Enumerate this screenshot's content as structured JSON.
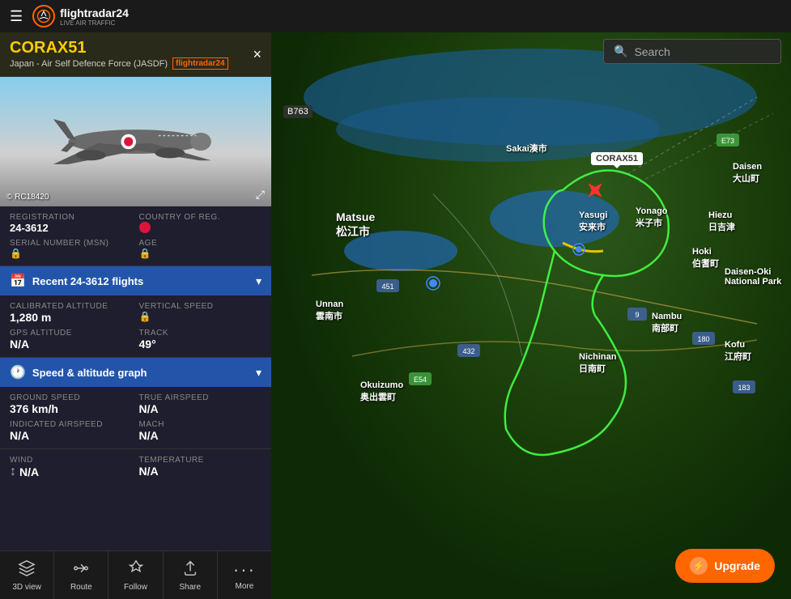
{
  "navbar": {
    "hamburger": "☰",
    "logo_text": "flightradar24",
    "logo_subtext": "LIVE AIR TRAFFIC"
  },
  "flight": {
    "callsign": "CORAX51",
    "airline": "Japan - Air Self Defence Force (JASDF)",
    "close_label": "×",
    "registration": "24-3612",
    "registration_label": "REGISTRATION",
    "country_label": "COUNTRY OF REG.",
    "serial_label": "SERIAL NUMBER (MSN)",
    "age_label": "AGE",
    "image_credit": "© RC18420",
    "recent_label": "Recent 24-3612 flights"
  },
  "flight_data": {
    "calibrated_altitude_label": "CALIBRATED ALTITUDE",
    "calibrated_altitude": "1,280 m",
    "vertical_speed_label": "VERTICAL SPEED",
    "gps_altitude_label": "GPS ALTITUDE",
    "gps_altitude": "N/A",
    "track_label": "TRACK",
    "track": "49°"
  },
  "speed_data": {
    "section_label": "Speed & altitude graph",
    "ground_speed_label": "GROUND SPEED",
    "ground_speed": "376 km/h",
    "true_airspeed_label": "TRUE AIRSPEED",
    "true_airspeed": "N/A",
    "indicated_airspeed_label": "INDICATED AIRSPEED",
    "indicated_airspeed": "N/A",
    "mach_label": "MACH",
    "mach": "N/A"
  },
  "wind_data": {
    "wind_label": "WIND",
    "wind": "N/A",
    "temperature_label": "TEMPERATURE",
    "temperature": "N/A"
  },
  "map": {
    "aircraft_label": "CORAX51",
    "b763_label": "B763",
    "cities": [
      {
        "name": "Matsue\n松江市",
        "class": "large"
      },
      {
        "name": "Sakai湊市"
      },
      {
        "name": "Yasugi\n安来市"
      },
      {
        "name": "Yonago\n米子市"
      },
      {
        "name": "Hiezu\n日吉津"
      },
      {
        "name": "Hoki\n伯耆町"
      },
      {
        "name": "Nichinan\n日南町"
      },
      {
        "name": "Unnan\n雲南市"
      },
      {
        "name": "Okuizumo\n奥出雲町"
      },
      {
        "name": "Daisen\n大山町"
      },
      {
        "name": "Daisen-Oki\nNational Park"
      },
      {
        "name": "Kofu\n江府町"
      },
      {
        "name": "Nambu\n南部町"
      }
    ],
    "search_placeholder": "Search",
    "upgrade_label": "Upgrade"
  },
  "bottom_nav": {
    "items": [
      {
        "label": "3D view",
        "icon": "⬡",
        "active": false
      },
      {
        "label": "Route",
        "icon": "⟶",
        "active": false
      },
      {
        "label": "Follow",
        "icon": "✦",
        "active": false
      },
      {
        "label": "Share",
        "icon": "↑",
        "active": false
      },
      {
        "label": "More",
        "icon": "•••",
        "active": false
      }
    ]
  },
  "colors": {
    "accent": "#ffcc00",
    "brand": "#ff6600",
    "nav_bg": "#1a1a1a",
    "panel_bg": "#1e1e2e",
    "header_bg": "#2a2a1a",
    "accordion_bg": "#2255aa"
  }
}
